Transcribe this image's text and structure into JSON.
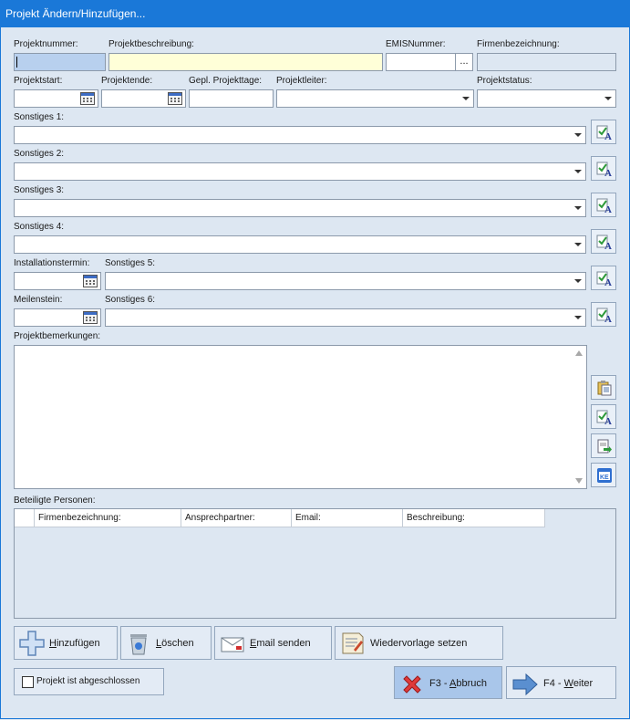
{
  "window": {
    "title": "Projekt Ändern/Hinzufügen..."
  },
  "labels": {
    "projektnummer": "Projektnummer:",
    "projektbeschreibung": "Projektbeschreibung:",
    "emisnummer": "EMISNummer:",
    "firmenbezeichnung": "Firmenbezeichnung:",
    "projektstart": "Projektstart:",
    "projektende": "Projektende:",
    "gepl_projekttage": "Gepl. Projekttage:",
    "projektleiter": "Projektleiter:",
    "projektstatus": "Projektstatus:",
    "sonstiges1": "Sonstiges 1:",
    "sonstiges2": "Sonstiges 2:",
    "sonstiges3": "Sonstiges 3:",
    "sonstiges4": "Sonstiges 4:",
    "installationstermin": "Installationstermin:",
    "sonstiges5": "Sonstiges 5:",
    "meilenstein": "Meilenstein:",
    "sonstiges6": "Sonstiges 6:",
    "projektbemerkungen": "Projektbemerkungen:",
    "beteiligte_personen": "Beteiligte Personen:"
  },
  "fields": {
    "projektnummer": "",
    "projektbeschreibung": "",
    "emisnummer": "",
    "firmenbezeichnung": "",
    "projektstart": "",
    "projektende": "",
    "gepl_projekttage": "",
    "projektleiter": "",
    "projektstatus": "",
    "sonstiges1": "",
    "sonstiges2": "",
    "sonstiges3": "",
    "sonstiges4": "",
    "installationstermin": "",
    "sonstiges5": "",
    "meilenstein": "",
    "sonstiges6": "",
    "projektbemerkungen": "",
    "emis_lookup": "..."
  },
  "table": {
    "columns": [
      "Firmenbezeichnung:",
      "Ansprechpartner:",
      "Email:",
      "Beschreibung:"
    ],
    "rows": []
  },
  "buttons": {
    "hinzufuegen_u": "H",
    "hinzufuegen_rest": "inzufügen",
    "loeschen_u": "L",
    "loeschen_rest": "öschen",
    "email_u": "E",
    "email_rest": "mail senden",
    "wiedervorlage": "Wiedervorlage setzen",
    "abbruch_pre": "F3 - ",
    "abbruch_u": "A",
    "abbruch_rest": "bbruch",
    "weiter_pre": "F4 - ",
    "weiter_u": "W",
    "weiter_rest": "eiter"
  },
  "checkbox": {
    "label": "Projekt ist abgeschlossen",
    "checked": false
  },
  "colors": {
    "titlebar": "#1a78d8",
    "background": "#dde7f2",
    "primary_button": "#a9c6ea"
  }
}
